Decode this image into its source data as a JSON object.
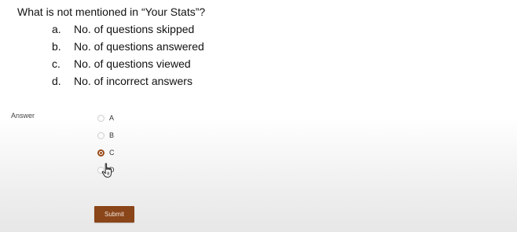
{
  "question": {
    "text": "What is not mentioned in “Your Stats”?",
    "options": [
      {
        "letter": "a.",
        "text": "No. of questions skipped"
      },
      {
        "letter": "b.",
        "text": "No. of questions answered"
      },
      {
        "letter": "c.",
        "text": "No. of questions viewed"
      },
      {
        "letter": "d.",
        "text": "No. of incorrect answers"
      }
    ]
  },
  "answer": {
    "label": "Answer",
    "choices": [
      {
        "label": "A",
        "selected": false
      },
      {
        "label": "B",
        "selected": false
      },
      {
        "label": "C",
        "selected": true
      },
      {
        "label": "D",
        "selected": false
      }
    ]
  },
  "submit": {
    "label": "Submit",
    "color": "#8a4519"
  },
  "colors": {
    "radio_selected": "#9a4a1a"
  },
  "icons": {
    "cursor": "hand-pointer-icon"
  }
}
